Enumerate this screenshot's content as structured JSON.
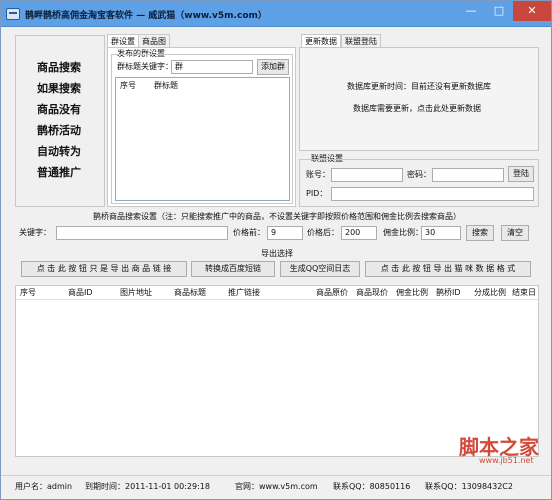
{
  "window": {
    "title": "鹊畔鹊桥高佣金淘宝客软件 — 威武猫（www.v5m.com）",
    "min": "—",
    "max": "□",
    "close": "✕"
  },
  "menu": {
    "items": [
      "商品搜索",
      "如果搜索",
      "商品没有",
      "鹊桥活动",
      "自动转为",
      "普通推广"
    ]
  },
  "group_panel": {
    "tabs": [
      "群设置",
      "商品图"
    ],
    "section_title": "发布的群设置",
    "keyword_label": "群标题关键字：",
    "keyword_value": "群",
    "add_button": "添加群",
    "columns": [
      "序号",
      "群标题"
    ]
  },
  "db_panel": {
    "tabs": [
      "更新数据",
      "联盟登陆"
    ],
    "update_time_text": "数据库更新时间：目前还没有更新数据库",
    "hint_text": "数据库需要更新，点击此处更新数据"
  },
  "alliance": {
    "title": "联盟设置",
    "account_label": "账号：",
    "account_value": "",
    "password_label": "密码：",
    "password_value": "",
    "login_button": "登陆",
    "pid_label": "PID：",
    "pid_value": ""
  },
  "search": {
    "title": "鹊桥商品搜索设置（注：只能搜索推广中的商品，不设置关键字即按照价格范围和佣金比例去搜索商品）",
    "keyword_label": "关键字：",
    "keyword_value": "",
    "price_min_label": "价格前：",
    "price_min_value": "9",
    "price_max_label": "价格后：",
    "price_max_value": "200",
    "commission_label": "佣金比例：",
    "commission_value": "30",
    "search_button": "搜索",
    "clear_button": "清空"
  },
  "export": {
    "title": "导出选择",
    "buttons": [
      "点 击 此 按 钮 只 是 导 出 商 品 链 接",
      "转换成百度短链",
      "生成QQ空间日志",
      "点 击 此 按 钮 导 出 猫 咪 数 据 格 式"
    ]
  },
  "results": {
    "columns": [
      "序号",
      "商品ID",
      "图片地址",
      "商品标题",
      "推广链接",
      "商品原价",
      "商品现价",
      "佣金比例",
      "鹊桥ID",
      "分成比例",
      "结束日"
    ]
  },
  "status": {
    "user": "用户名：admin",
    "expire": "到期时间：2011-11-01 00:29:18",
    "site": "官网：www.v5m.com",
    "qq1": "联系QQ：80850116",
    "qq2": "联系QQ：13098432C2"
  },
  "watermark": {
    "text": "脚本之家",
    "sub": "www.jb51.net"
  }
}
